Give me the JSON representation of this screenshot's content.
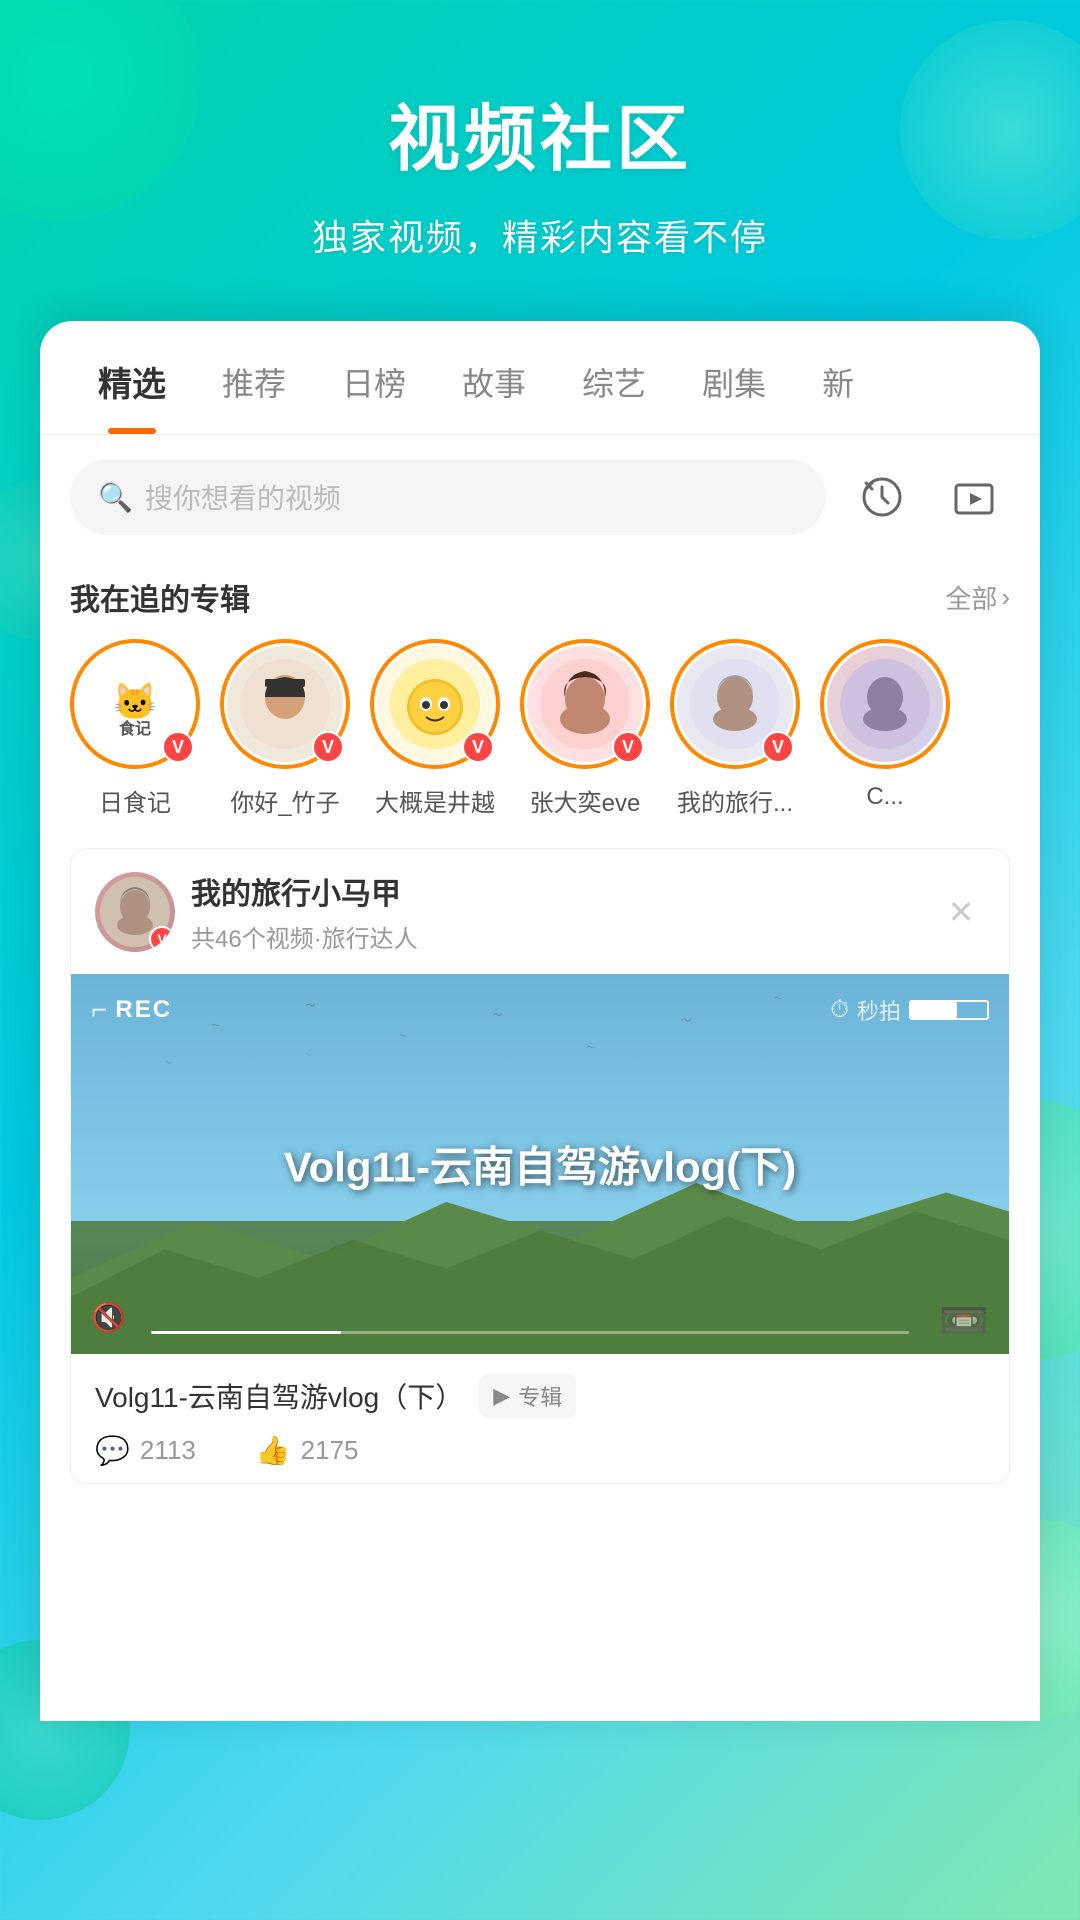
{
  "page": {
    "title": "视频社区",
    "subtitle": "独家视频，精彩内容看不停"
  },
  "tabs": {
    "items": [
      {
        "label": "精选",
        "active": true
      },
      {
        "label": "推荐",
        "active": false
      },
      {
        "label": "日榜",
        "active": false
      },
      {
        "label": "故事",
        "active": false
      },
      {
        "label": "综艺",
        "active": false
      },
      {
        "label": "剧集",
        "active": false
      },
      {
        "label": "新",
        "active": false
      }
    ]
  },
  "search": {
    "placeholder": "搜你想看的视频"
  },
  "subscriptions": {
    "section_title": "我在追的专辑",
    "more_label": "全部",
    "items": [
      {
        "name": "日食记",
        "emoji": "🐱"
      },
      {
        "name": "你好_竹子",
        "emoji": "👩"
      },
      {
        "name": "大概是井越",
        "emoji": "🐥"
      },
      {
        "name": "张大奕eve",
        "emoji": "👩"
      },
      {
        "name": "我的旅行...",
        "emoji": "🧑"
      },
      {
        "name": "C...",
        "emoji": "🎭"
      }
    ]
  },
  "featured": {
    "channel_name": "我的旅行小马甲",
    "channel_meta": "共46个视频·旅行达人",
    "video_title": "Volg11-云南自驾游vlog（下）",
    "video_overlay": "Volg11-云南自驾游vlog(下)",
    "album_label": "专辑",
    "stats": {
      "comments": "2113",
      "likes": "2175"
    },
    "rec_label": "REC"
  }
}
